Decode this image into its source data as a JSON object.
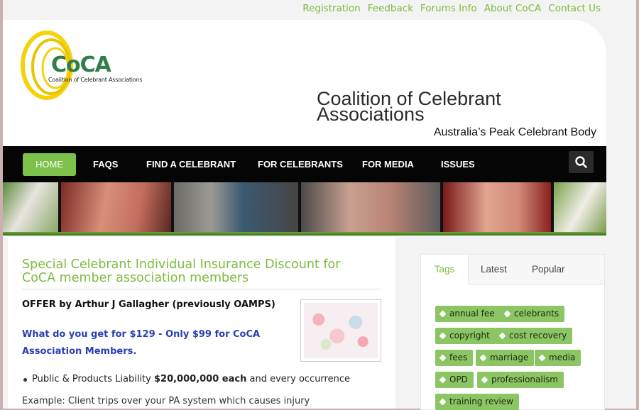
{
  "top_links": [
    "Registration",
    "Feedback",
    "Forums Info",
    "About CoCA",
    "Contact Us"
  ],
  "logo": {
    "name": "CoCA",
    "subtitle": "Coalition of Celebrant Associations"
  },
  "site": {
    "title_line1": "Coalition of Celebrant",
    "title_line2": "Associations",
    "tagline": "Australia’s Peak Celebrant Body"
  },
  "nav": {
    "home": "HOME",
    "faqs": "FAQS",
    "find": "FIND A CELEBRANT",
    "for_celebrants": "FOR CELEBRANTS",
    "for_media": "FOR MEDIA",
    "issues": "ISSUES",
    "search_icon": "search-icon"
  },
  "article": {
    "title": "Special Celebrant Individual Insurance Discount for CoCA member association members",
    "offer": "OFFER by Arthur J Gallagher (previously OAMPS)",
    "what": "What do you get for $129 - Only $99 for CoCA Association Members.",
    "bullet_pre": "Public & Products Liability ",
    "bullet_bold": "$20,000,000 each",
    "bullet_post": " and every occurrence",
    "example": "Example: Client trips over your PA system which causes injury"
  },
  "sidebar": {
    "tabs": [
      "Tags",
      "Latest",
      "Popular"
    ],
    "tags": [
      "annual fee",
      "celebrants",
      "copyright",
      "cost recovery",
      "fees",
      "marriage",
      "media",
      "OPD",
      "professionalism",
      "training review"
    ]
  },
  "colors": {
    "accent": "#7dbb3e",
    "nav_bg": "#050505",
    "link_blue": "#2a3fb4"
  }
}
